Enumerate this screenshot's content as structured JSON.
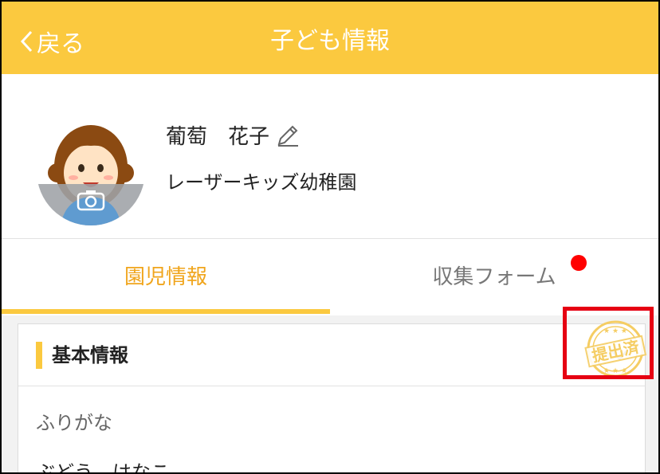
{
  "header": {
    "back_label": "戻る",
    "title": "子ども情報"
  },
  "profile": {
    "name": "葡萄　花子",
    "school": "レーザーキッズ幼稚園"
  },
  "tabs": [
    {
      "label": "園児情報",
      "active": true
    },
    {
      "label": "収集フォーム",
      "has_notification": true
    }
  ],
  "section": {
    "title": "基本情報",
    "stamp_text": "提出済",
    "field_label": "ふりがな",
    "field_value": "ぶどう　はなこ"
  },
  "colors": {
    "accent": "#fbc93f",
    "active_tab_text": "#f0a51c",
    "notification": "#ff0000",
    "highlight_box": "#e60012",
    "stamp": "#f5cd63"
  }
}
